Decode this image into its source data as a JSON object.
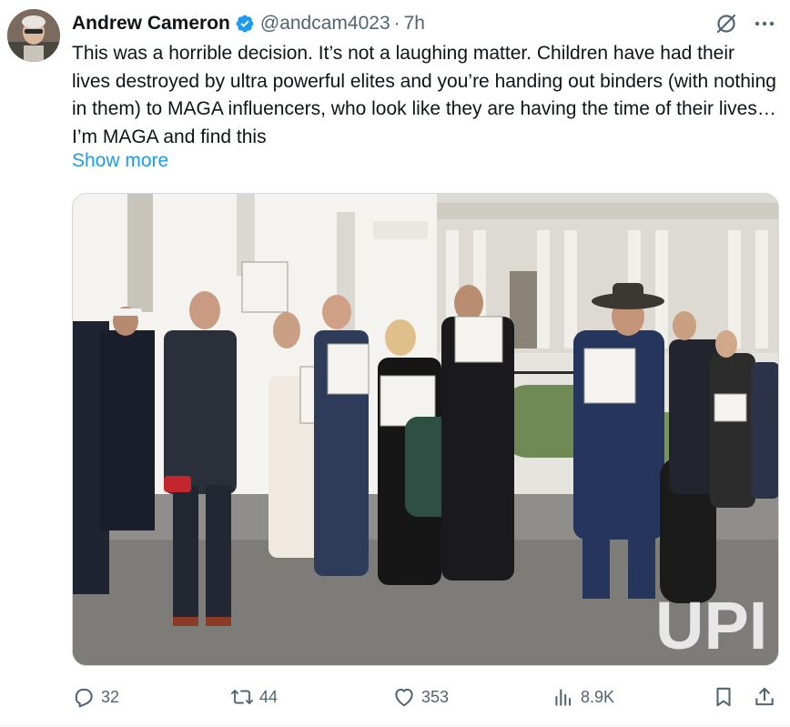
{
  "author": {
    "name": "Andrew Cameron",
    "handle": "@andcam4023",
    "separator": "·",
    "time": "7h",
    "verified": true,
    "verified_color": "#1d9bf0"
  },
  "tweet": {
    "text": "This was a horrible decision.  It’s not a laughing matter. Children have had their lives destroyed by ultra powerful elites and you’re handing out binders (with nothing in them) to MAGA influencers, who look like they are having the time of their lives… I’m MAGA and find this",
    "show_more": "Show more"
  },
  "media": {
    "watermark": "UPI",
    "icon": "photo"
  },
  "actions": {
    "replies": "32",
    "reposts": "44",
    "likes": "353",
    "views": "8.9K"
  },
  "icons": {
    "grok": "grok-icon",
    "more": "more-icon",
    "reply": "reply-icon",
    "repost": "repost-icon",
    "like": "heart-icon",
    "views": "views-icon",
    "bookmark": "bookmark-icon",
    "share": "share-icon"
  },
  "colors": {
    "text": "#0f1419",
    "secondary": "#536471",
    "link": "#1d9bf0"
  }
}
